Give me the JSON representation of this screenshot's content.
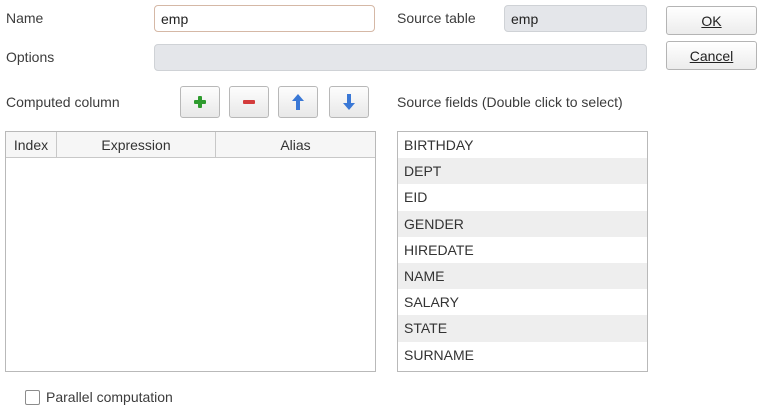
{
  "form": {
    "name_label": "Name",
    "name_value": "emp",
    "source_table_label": "Source table",
    "source_table_value": "emp",
    "options_label": "Options",
    "options_value": "",
    "computed_column_label": "Computed column",
    "source_fields_label": "Source fields (Double click to select)"
  },
  "buttons": {
    "ok_label": "OK",
    "cancel_label": "Cancel"
  },
  "toolbar": {
    "icons": [
      "add-icon",
      "remove-icon",
      "move-up-icon",
      "move-down-icon"
    ],
    "colors": {
      "add": "#2e9b2e",
      "remove": "#d33b3b",
      "arrow": "#3a78d6"
    }
  },
  "table": {
    "columns": [
      "Index",
      "Expression",
      "Alias"
    ],
    "rows": []
  },
  "source_fields": [
    "BIRTHDAY",
    "DEPT",
    "EID",
    "GENDER",
    "HIREDATE",
    "NAME",
    "SALARY",
    "STATE",
    "SURNAME"
  ],
  "parallel": {
    "label": "Parallel computation",
    "checked": false
  }
}
